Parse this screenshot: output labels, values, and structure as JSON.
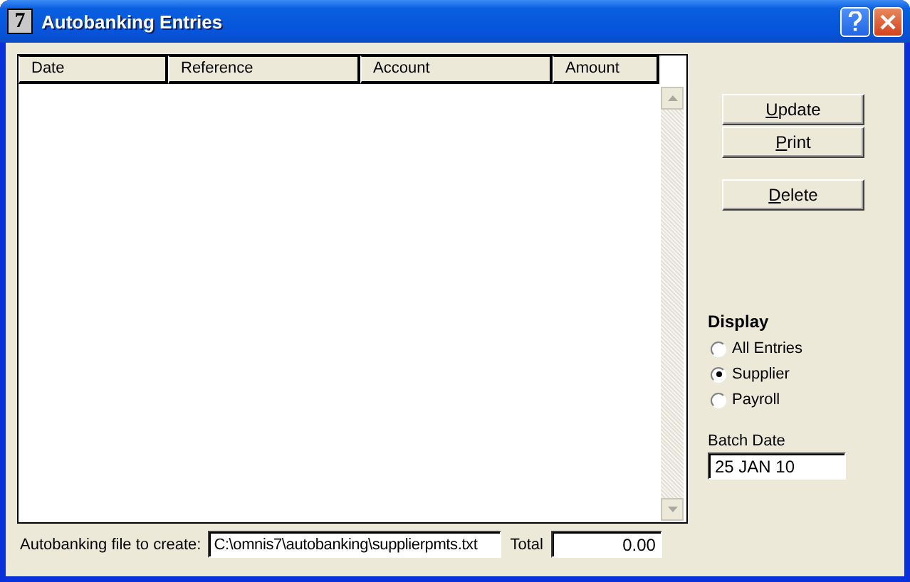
{
  "window": {
    "app_icon": "7",
    "title": "Autobanking Entries"
  },
  "table": {
    "columns": [
      "Date",
      "Reference",
      "Account",
      "Amount"
    ]
  },
  "buttons": [
    {
      "label": "Update"
    },
    {
      "label": "Print"
    },
    {
      "label": "Delete"
    }
  ],
  "display": {
    "title": "Display",
    "options": [
      {
        "label": "All Entries",
        "selected": false
      },
      {
        "label": "Supplier",
        "selected": true
      },
      {
        "label": "Payroll",
        "selected": false
      }
    ]
  },
  "batch_date": {
    "label": "Batch Date",
    "value": "25 JAN 10"
  },
  "file": {
    "label": "Autobanking file to create:",
    "value": "C:\\omnis7\\autobanking\\supplierpmts.txt"
  },
  "total": {
    "label": "Total",
    "value": "0.00"
  }
}
